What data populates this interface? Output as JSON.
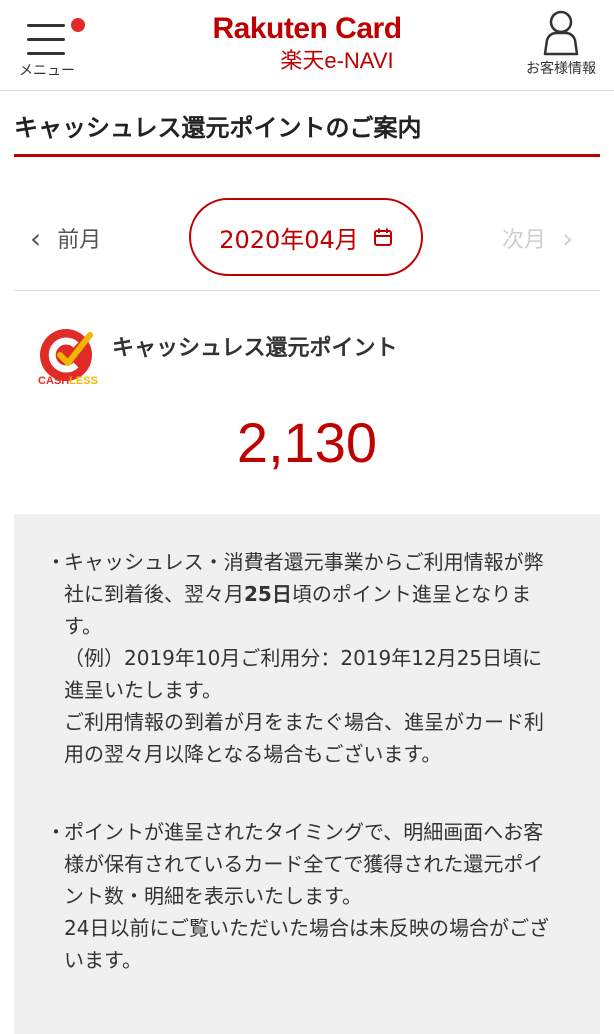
{
  "header": {
    "menu_label": "メニュー",
    "logo_main": "Rakuten Card",
    "logo_sub": "楽天e-NAVI",
    "account_label": "お客様情報"
  },
  "page": {
    "title": "キャッシュレス還元ポイントのご案内"
  },
  "month_nav": {
    "prev_label": "前月",
    "current": "2020年04月",
    "next_label": "次月"
  },
  "cashless": {
    "logo_text_1": "CASH",
    "logo_text_2": "LESS",
    "title": "キャッシュレス還元ポイント",
    "points": "2,130"
  },
  "notes": {
    "bullet": "・",
    "note1_pre": "キャッシュレス・消費者還元事業からご利用情報が弊社に到着後、翌々月",
    "note1_bold": "25日",
    "note1_post": "頃のポイント進呈となります。",
    "note1_example": "（例）2019年10月ご利用分：2019年12月25日頃に進呈いたします。",
    "note1_extra": "ご利用情報の到着が月をまたぐ場合、進呈がカード利用の翌々月以降となる場合もございます。",
    "note2": "ポイントが進呈されたタイミングで、明細画面へお客様が保有されているカード全てで獲得された還元ポイント数・明細を表示いたします。",
    "note2_extra": "24日以前にご覧いただいた場合は未反映の場合がございます。"
  },
  "colors": {
    "brand_red": "#bf0000",
    "notice_dot": "#e02b27",
    "cashless_yellow": "#f2b600",
    "disabled_gray": "#cfcfcf"
  }
}
